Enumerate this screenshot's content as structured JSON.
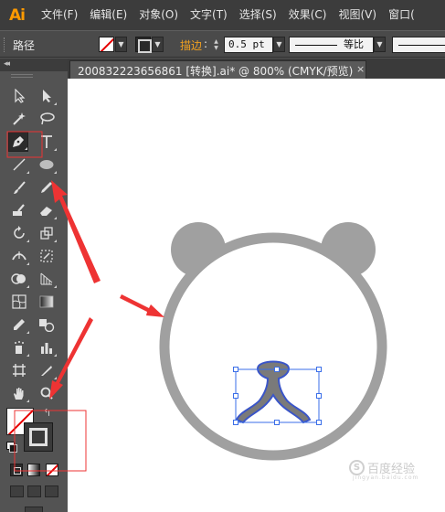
{
  "app": {
    "logo": "Ai",
    "brand_color": "#ff9a00"
  },
  "menubar": {
    "items": [
      "文件(F)",
      "编辑(E)",
      "对象(O)",
      "文字(T)",
      "选择(S)",
      "效果(C)",
      "视图(V)",
      "窗口("
    ]
  },
  "controlbar": {
    "selection_label": "路径",
    "stroke_label": "描边",
    "stroke_colon": ":",
    "stroke_weight": "0.5 pt",
    "profile_label": "等比"
  },
  "toolbox": {
    "collapse": "◂◂",
    "swap": "↰",
    "tools": [
      "selection-tool",
      "direct-selection-tool",
      "magic-wand-tool",
      "lasso-tool",
      "pen-tool",
      "type-tool",
      "line-segment-tool",
      "ellipse-tool",
      "paintbrush-tool",
      "pencil-tool",
      "blob-brush-tool",
      "eraser-tool",
      "rotate-tool",
      "scale-tool",
      "width-tool",
      "free-transform-tool",
      "shape-builder-tool",
      "perspective-grid-tool",
      "mesh-tool",
      "gradient-tool",
      "eyedropper-tool",
      "blend-tool",
      "symbol-sprayer-tool",
      "column-graph-tool",
      "artboard-tool",
      "slice-tool",
      "hand-tool",
      "zoom-tool"
    ],
    "selected_tool": "pen-tool"
  },
  "document": {
    "tab_title": "20083222365686​1  [转换].ai* @ 800% (CMYK/预览)",
    "close": "×"
  },
  "watermark": {
    "mark": "S",
    "text": "百度经验",
    "sub": "jingyan.baidu.com"
  },
  "colors": {
    "annotation_red": "#ee3333",
    "bear_gray": "#a0a0a0",
    "path_blue": "#3a55c8",
    "stroke_red_none": "#e60000"
  }
}
